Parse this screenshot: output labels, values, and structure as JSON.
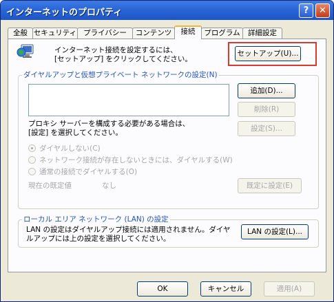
{
  "window": {
    "title": "インターネットのプロパティ"
  },
  "titlebar_buttons": {
    "help": "?",
    "close": "✕"
  },
  "tabs": [
    {
      "label": "全般"
    },
    {
      "label": "セキュリティ"
    },
    {
      "label": "プライバシー"
    },
    {
      "label": "コンテンツ"
    },
    {
      "label": "接続",
      "active": true
    },
    {
      "label": "プログラム"
    },
    {
      "label": "詳細設定"
    }
  ],
  "setup": {
    "text_line1": "インターネット接続を設定するには、",
    "text_line2": "[セットアップ] をクリックしてください。",
    "button": "セットアップ(U)...",
    "icon": "globe-computer-icon"
  },
  "dialup": {
    "group_label": "ダイヤルアップと仮想プライベート ネットワークの設定(N)",
    "add_button": "追加(D)...",
    "remove_button": "削除(R)",
    "proxy_text_line1": "プロキシ サーバーを構成する必要がある場合は、",
    "proxy_text_line2": "[設定] を選択してください。",
    "settings_button": "設定(S)...",
    "radio_options": [
      {
        "label": "ダイヤルしない(C)",
        "selected": true
      },
      {
        "label": "ネットワーク接続が存在しないときには、ダイヤルする(W)",
        "selected": false
      },
      {
        "label": "通常の接続でダイヤルする(O)",
        "selected": false
      }
    ],
    "default_label": "現在の既定値",
    "default_value": "なし",
    "set_default_button": "既定に設定(E)"
  },
  "lan": {
    "group_label": "ローカル エリア ネットワーク (LAN) の設定",
    "text_line1": "LAN の設定はダイヤルアップ接続には適用されません。ダイヤ",
    "text_line2": "ルアップには上の設定を選択してください。",
    "button": "LAN の設定(L)..."
  },
  "footer": {
    "ok": "OK",
    "cancel": "キャンセル",
    "apply": "適用(A)"
  },
  "colors": {
    "titlebar": "#2a66d8",
    "highlight_border": "#d93a2b",
    "group_label": "#2452c4",
    "active_tab_accent": "#f4b22f"
  }
}
